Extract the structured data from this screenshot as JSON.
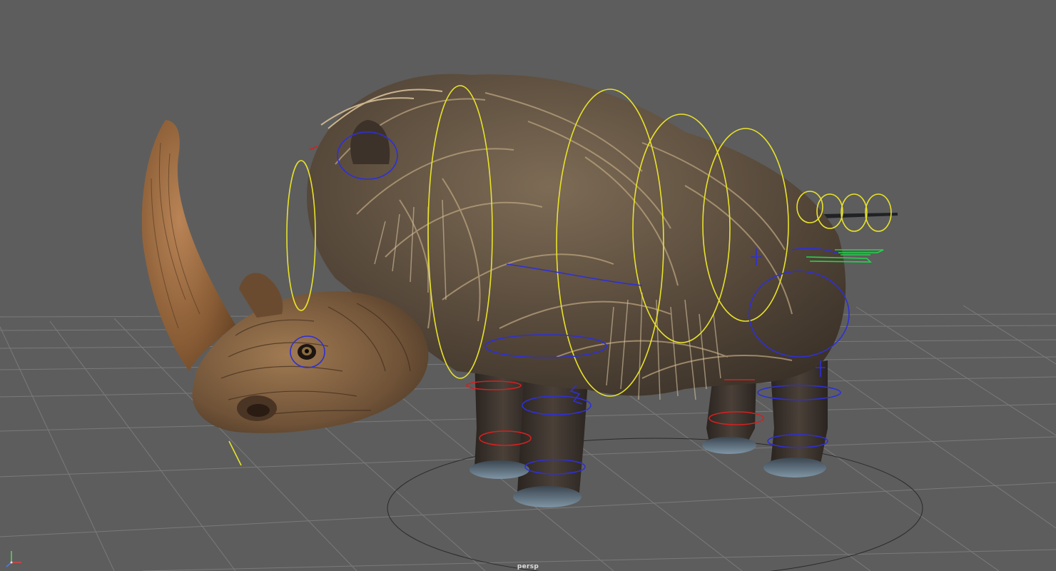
{
  "viewport": {
    "camera_label": "persp",
    "background_color": "#5d5d5d",
    "grid_color": "#7a7a7a",
    "icons": [
      "axis-gizmo-icon"
    ]
  },
  "scene": {
    "model": "woolly-rhinoceros",
    "rig_control_colors": {
      "spine": "#e8e22a",
      "leg": "#2f2fd6",
      "leg_ik": "#d42020",
      "tail_fk": "#e8e22a",
      "tail_ik": "#22d44a"
    }
  }
}
